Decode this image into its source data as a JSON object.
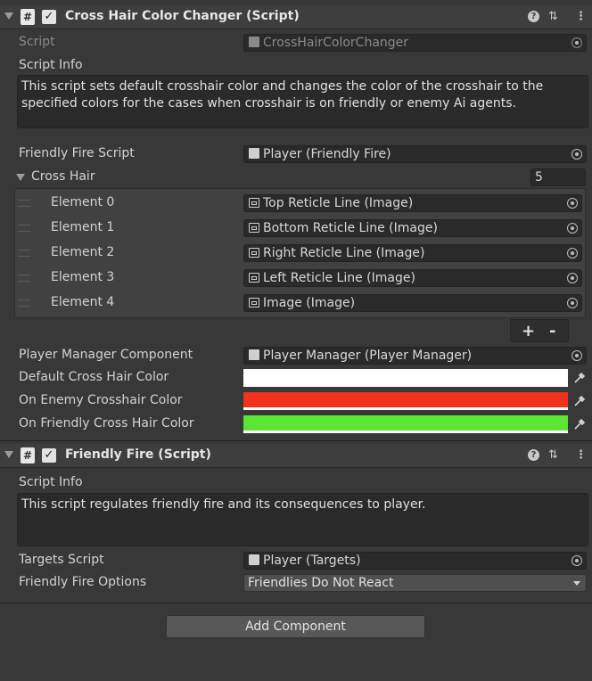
{
  "component1": {
    "title": "Cross Hair Color Changer (Script)",
    "script_label": "Script",
    "script_value": "CrossHairColorChanger",
    "info_label": "Script Info",
    "info_text": "This script sets default crosshair color and  changes the color of the crosshair to the specified colors for the cases when crosshair is on friendly or  enemy Ai agents.",
    "friendly_fire_label": "Friendly Fire Script",
    "friendly_fire_value": "Player (Friendly Fire)",
    "cross_hair_label": "Cross Hair",
    "cross_hair_size": "5",
    "elements": [
      {
        "label": "Element 0",
        "value": "Top Reticle Line (Image)"
      },
      {
        "label": "Element 1",
        "value": "Bottom Reticle Line  (Image)"
      },
      {
        "label": "Element 2",
        "value": "Right Reticle Line  (Image)"
      },
      {
        "label": "Element 3",
        "value": "Left Reticle Line (Image)"
      },
      {
        "label": "Element 4",
        "value": "Image (Image)"
      }
    ],
    "add_symbol": "+",
    "remove_symbol": "-",
    "player_manager_label": "Player Manager Component",
    "player_manager_value": "Player Manager (Player Manager)",
    "default_color_label": "Default Cross Hair Color",
    "default_color": "#ffffff",
    "enemy_color_label": "On Enemy Crosshair Color",
    "enemy_color": "#f0321e",
    "friendly_color_label": "On Friendly Cross Hair Color",
    "friendly_color": "#5ae632"
  },
  "component2": {
    "title": "Friendly Fire (Script)",
    "info_label": "Script Info",
    "info_text": "This script regulates friendly fire and its consequences to player.",
    "targets_label": "Targets Script",
    "targets_value": "Player (Targets)",
    "options_label": "Friendly Fire Options",
    "options_value": "Friendlies Do Not React"
  },
  "add_component_label": "Add Component",
  "icons": [
    "foldout-icon",
    "script-icon",
    "checkbox-icon",
    "help-icon",
    "settings-icon",
    "menu-icon",
    "object-picker-icon",
    "image-icon",
    "eyedropper-icon",
    "dropdown-icon"
  ]
}
